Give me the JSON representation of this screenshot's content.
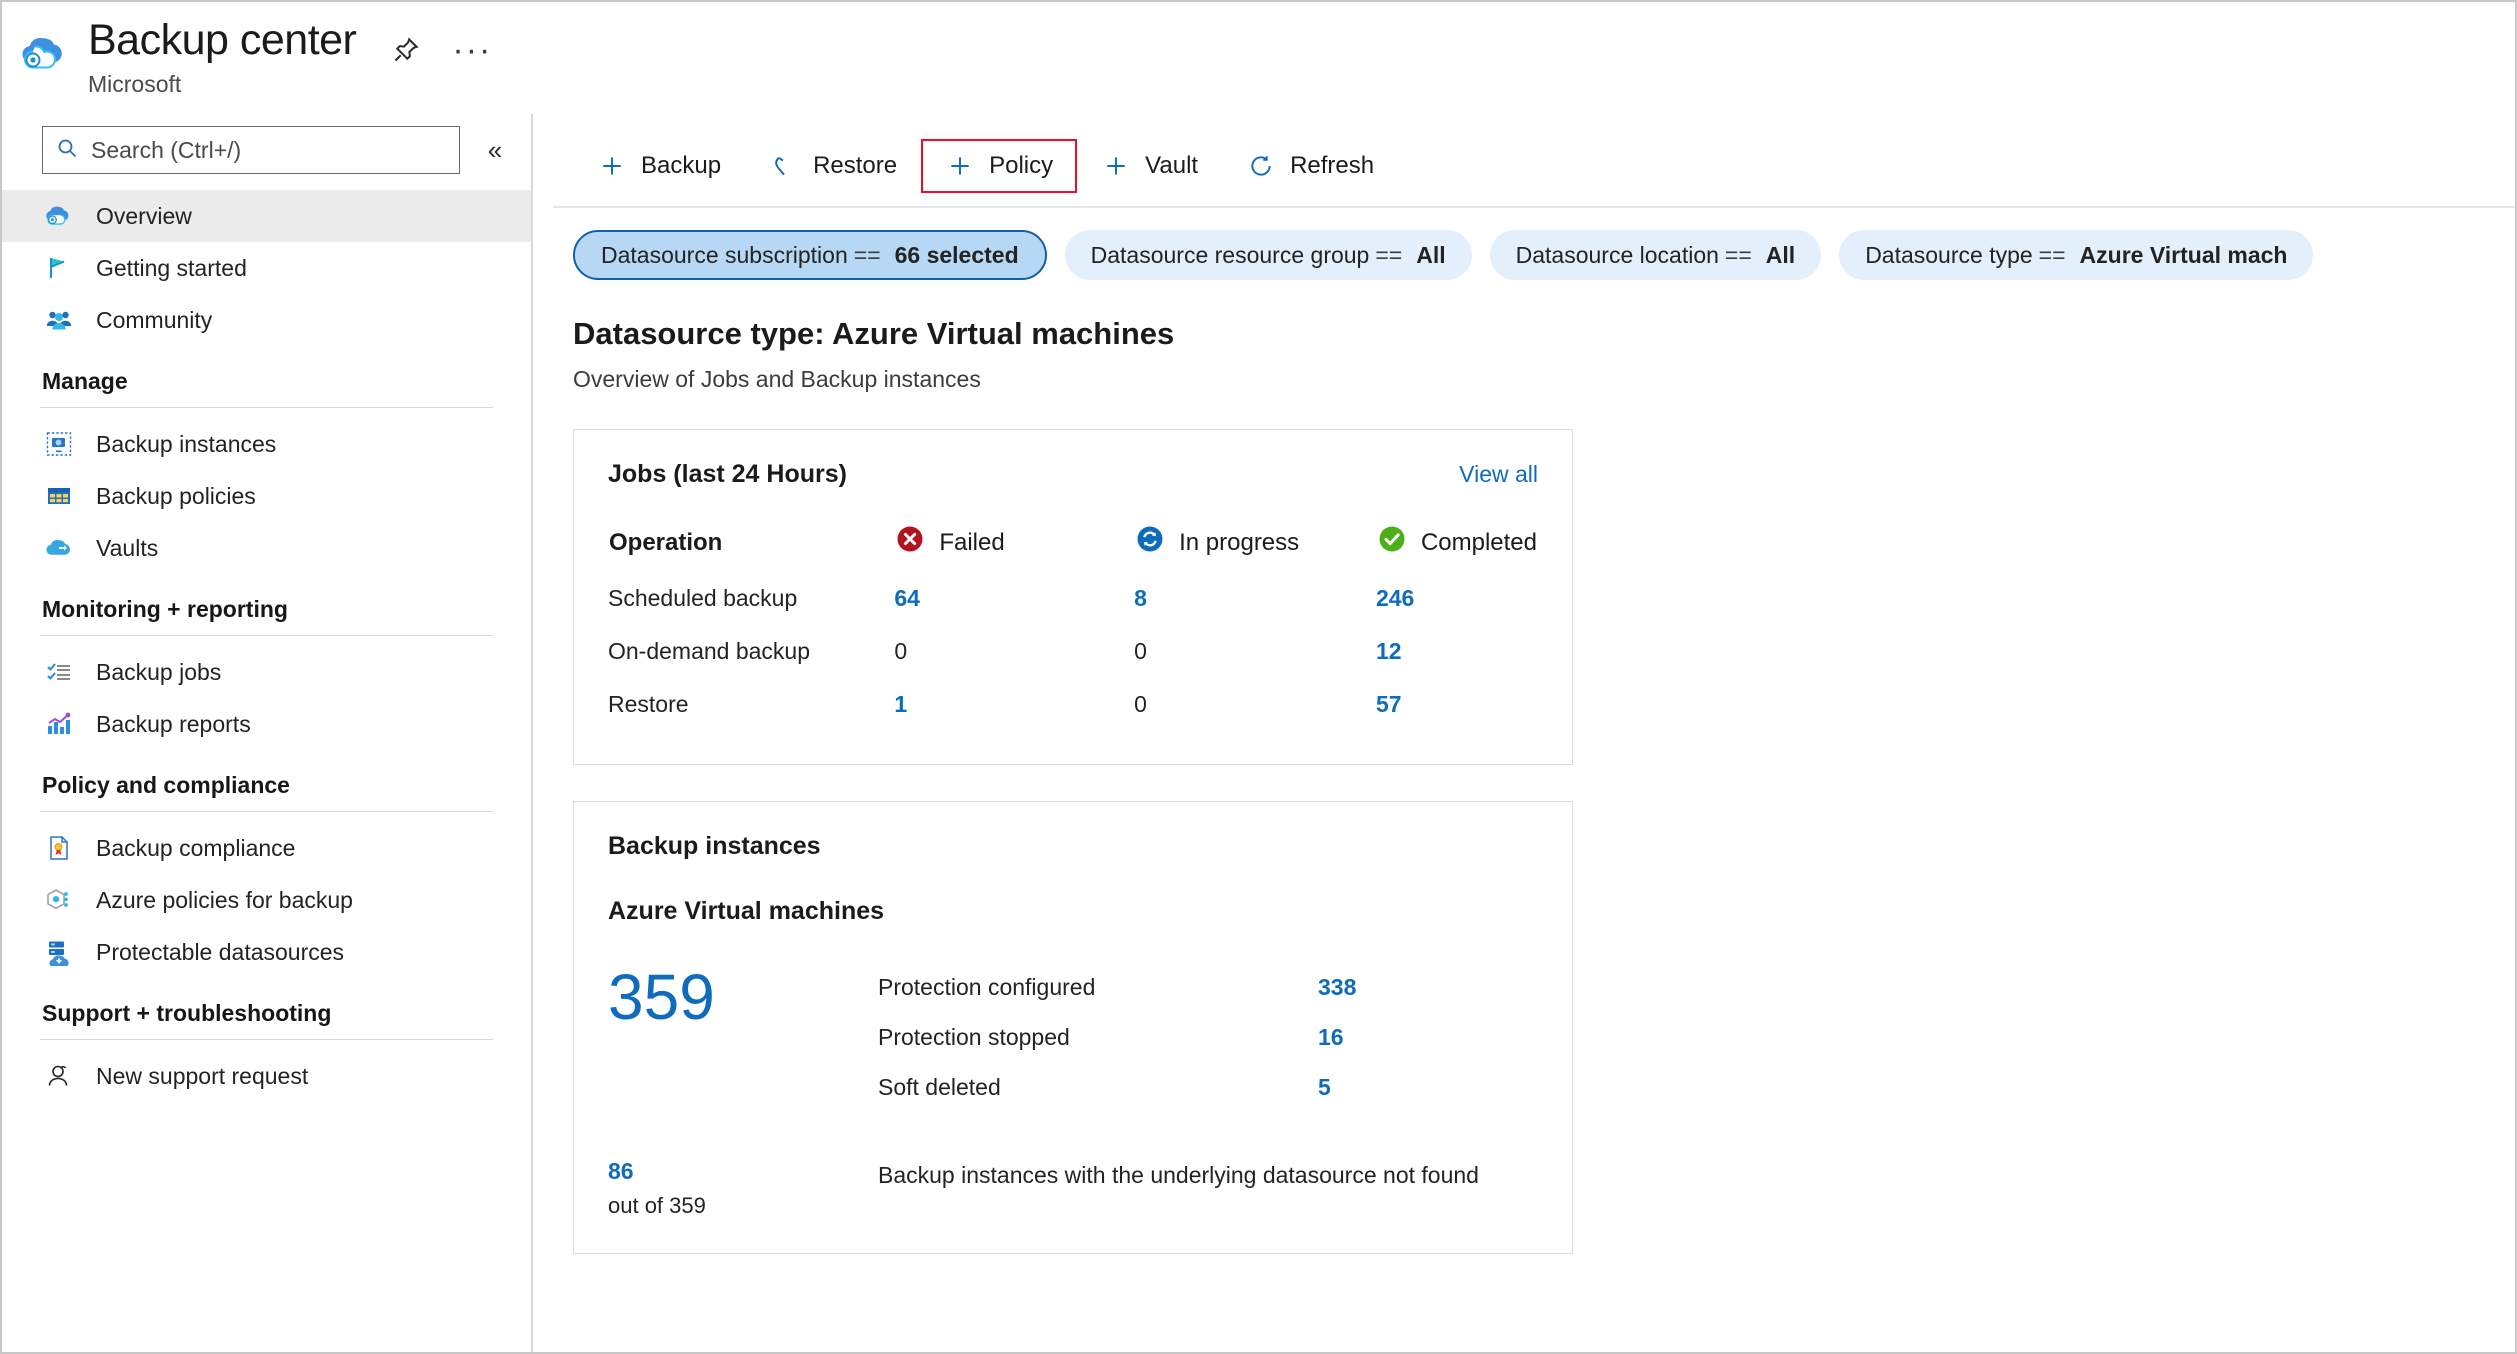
{
  "header": {
    "title": "Backup center",
    "subtitle": "Microsoft",
    "pin_icon": "pin-icon",
    "more_icon": "ellipsis-icon",
    "more_label": "···"
  },
  "sidebar": {
    "search": {
      "placeholder": "Search (Ctrl+/)",
      "value": "",
      "icon": "search-icon"
    },
    "collapse_label": "«",
    "top_items": [
      {
        "label": "Overview",
        "icon": "backup-center-cloud-icon",
        "active": true
      },
      {
        "label": "Getting started",
        "icon": "flag-icon",
        "active": false
      },
      {
        "label": "Community",
        "icon": "people-icon",
        "active": false
      }
    ],
    "sections": [
      {
        "title": "Manage",
        "items": [
          {
            "label": "Backup instances",
            "icon": "backup-instance-icon"
          },
          {
            "label": "Backup policies",
            "icon": "policy-table-icon"
          },
          {
            "label": "Vaults",
            "icon": "vault-cloud-icon"
          }
        ]
      },
      {
        "title": "Monitoring + reporting",
        "items": [
          {
            "label": "Backup jobs",
            "icon": "checklist-icon"
          },
          {
            "label": "Backup reports",
            "icon": "bar-chart-icon"
          }
        ]
      },
      {
        "title": "Policy and compliance",
        "items": [
          {
            "label": "Backup compliance",
            "icon": "compliance-document-icon"
          },
          {
            "label": "Azure policies for backup",
            "icon": "azure-policy-icon"
          },
          {
            "label": "Protectable datasources",
            "icon": "datasource-cloud-icon"
          }
        ]
      },
      {
        "title": "Support + troubleshooting",
        "items": [
          {
            "label": "New support request",
            "icon": "support-person-icon"
          }
        ]
      }
    ]
  },
  "toolbar": {
    "buttons": [
      {
        "label": "Backup",
        "icon": "plus-icon",
        "highlighted": false
      },
      {
        "label": "Restore",
        "icon": "restore-arrow-icon",
        "highlighted": false
      },
      {
        "label": "Policy",
        "icon": "plus-icon",
        "highlighted": true
      },
      {
        "label": "Vault",
        "icon": "plus-icon",
        "highlighted": false
      },
      {
        "label": "Refresh",
        "icon": "refresh-icon",
        "highlighted": false
      }
    ],
    "highlight_color": "#e81123",
    "accent_color": "#0f6cbd"
  },
  "filters": [
    {
      "name": "Datasource subscription",
      "operator": "==",
      "value": "66 selected",
      "selected": true
    },
    {
      "name": "Datasource resource group",
      "operator": "==",
      "value": "All",
      "selected": false
    },
    {
      "name": "Datasource location",
      "operator": "==",
      "value": "All",
      "selected": false
    },
    {
      "name": "Datasource type",
      "operator": "==",
      "value": "Azure Virtual mach",
      "selected": false
    }
  ],
  "content": {
    "title": "Datasource type: Azure Virtual machines",
    "subtitle": "Overview of Jobs and Backup instances"
  },
  "jobs_card": {
    "title": "Jobs (last 24 Hours)",
    "view_all": "View all",
    "columns": [
      {
        "label": "Operation",
        "icon": null
      },
      {
        "label": "Failed",
        "icon": "failed-x-icon",
        "color": "#b3121e"
      },
      {
        "label": "In progress",
        "icon": "in-progress-sync-icon",
        "color": "#0f6cbd"
      },
      {
        "label": "Completed",
        "icon": "completed-check-icon",
        "color": "#4caf18"
      }
    ],
    "rows": [
      {
        "operation": "Scheduled backup",
        "failed": "64",
        "in_progress": "8",
        "completed": "246"
      },
      {
        "operation": "On-demand backup",
        "failed": "0",
        "in_progress": "0",
        "completed": "12"
      },
      {
        "operation": "Restore",
        "failed": "1",
        "in_progress": "0",
        "completed": "57"
      }
    ]
  },
  "instances_card": {
    "title": "Backup instances",
    "subtitle": "Azure Virtual machines",
    "total": "359",
    "rows": [
      {
        "label": "Protection configured",
        "value": "338"
      },
      {
        "label": "Protection stopped",
        "value": "16"
      },
      {
        "label": "Soft deleted",
        "value": "5"
      }
    ],
    "footer": {
      "count": "86",
      "out_of": "out of 359",
      "description": "Backup instances with the underlying datasource not found"
    }
  },
  "chart_data": {
    "type": "table",
    "title": "Jobs (last 24 Hours)",
    "categories": [
      "Scheduled backup",
      "On-demand backup",
      "Restore"
    ],
    "series": [
      {
        "name": "Failed",
        "values": [
          64,
          0,
          1
        ]
      },
      {
        "name": "In progress",
        "values": [
          8,
          0,
          0
        ]
      },
      {
        "name": "Completed",
        "values": [
          246,
          12,
          57
        ]
      }
    ],
    "xlabel": "Operation",
    "ylabel": "",
    "legend_position": "top",
    "grid": false,
    "secondary": {
      "type": "table",
      "title": "Backup instances — Azure Virtual machines",
      "total": 359,
      "categories": [
        "Protection configured",
        "Protection stopped",
        "Soft deleted",
        "Backup instances with the underlying datasource not found"
      ],
      "values": [
        338,
        16,
        5,
        86
      ]
    }
  }
}
